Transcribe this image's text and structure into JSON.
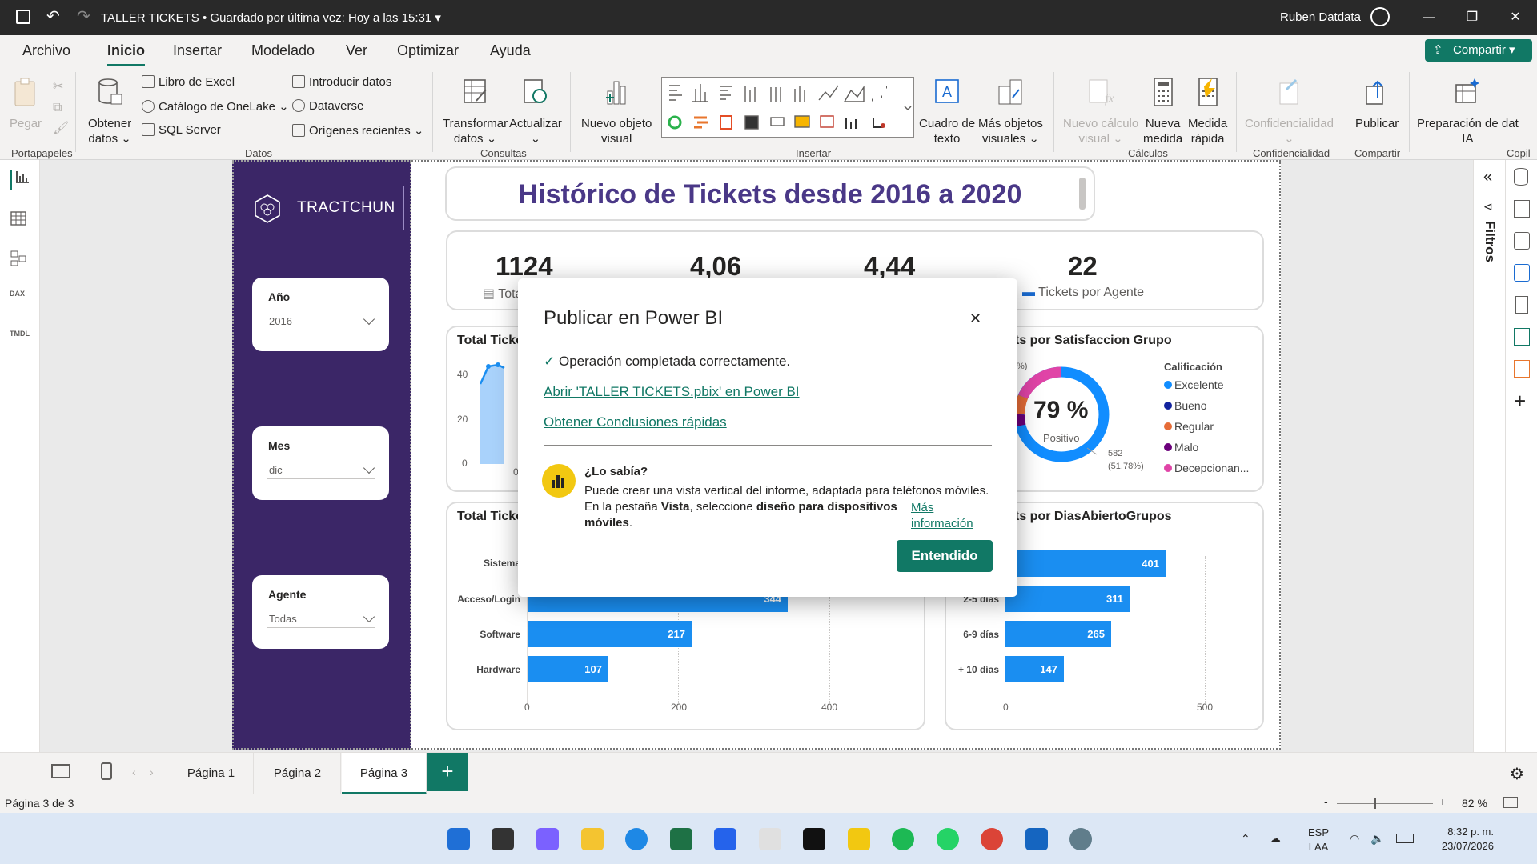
{
  "titlebar": {
    "doc_title": "TALLER TICKETS",
    "saved": "Guardado por última vez: Hoy a las 15:31",
    "user": "Ruben Datdata"
  },
  "menu": [
    "Archivo",
    "Inicio",
    "Insertar",
    "Modelado",
    "Ver",
    "Optimizar",
    "Ayuda"
  ],
  "share_label": "Compartir",
  "ribbon": {
    "pegar": "Pegar",
    "obtener": [
      "Obtener",
      "datos"
    ],
    "excel": "Libro de Excel",
    "onelake": "Catálogo de OneLake",
    "sql": "SQL Server",
    "introducir": "Introducir datos",
    "dataverse": "Dataverse",
    "origenes": "Orígenes recientes",
    "transformar": [
      "Transformar",
      "datos"
    ],
    "actualizar": "Actualizar",
    "nuevo_visual": [
      "Nuevo objeto",
      "visual"
    ],
    "cuadro_texto": [
      "Cuadro de",
      "texto"
    ],
    "mas_objetos": [
      "Más objetos",
      "visuales"
    ],
    "nuevo_calculo": [
      "Nuevo cálculo",
      "visual"
    ],
    "nueva_medida": [
      "Nueva",
      "medida"
    ],
    "medida_rapida": [
      "Medida",
      "rápida"
    ],
    "confidencialidad": "Confidencialidad",
    "publicar": "Publicar",
    "preparacion": [
      "Preparación de dat",
      "IA"
    ],
    "groups": {
      "portapapeles": "Portapapeles",
      "datos": "Datos",
      "consultas": "Consultas",
      "insertar": "Insertar",
      "calculos": "Cálculos",
      "confidencialidad": "Confidencialidad",
      "compartir": "Compartir",
      "copilot": "Copil"
    }
  },
  "report": {
    "logo": "TRACTCHUN",
    "title": "Histórico de Tickets desde 2016 a 2020",
    "slicers": [
      {
        "label": "Año",
        "value": "2016"
      },
      {
        "label": "Mes",
        "value": "dic"
      },
      {
        "label": "Agente",
        "value": "Todas"
      }
    ],
    "kpis": [
      {
        "value": "1124",
        "label": "Tota"
      },
      {
        "value": "4,06",
        "label": ""
      },
      {
        "value": "4,44",
        "label": ""
      },
      {
        "value": "22",
        "label": "Tickets por Agente"
      }
    ],
    "visual_titles": {
      "line": "Total Ticke",
      "donut": "ts por Satisfaccion Grupo",
      "bar_left": "Total Ticke",
      "bar_right": "ts por DiasAbiertoGrupos"
    },
    "line_axis": [
      "40",
      "20",
      "0"
    ],
    "line_xfrag": "0",
    "donut": {
      "center_value": "79 %",
      "center_label": "Positivo",
      "left_frag": "%)",
      "right_label_1": "582",
      "right_label_2": "(51,78%)",
      "legend_title": "Calificación",
      "legend": [
        {
          "name": "Excelente",
          "color": "#118dff"
        },
        {
          "name": "Bueno",
          "color": "#12239e"
        },
        {
          "name": "Regular",
          "color": "#e66c37"
        },
        {
          "name": "Malo",
          "color": "#6b007b"
        },
        {
          "name": "Decepcionan...",
          "color": "#e044a7"
        }
      ]
    },
    "bar_left": {
      "categories": [
        "Sistema",
        "Acceso/Login",
        "Software",
        "Hardware"
      ],
      "values": [
        null,
        344,
        217,
        107
      ],
      "value_labels": [
        "",
        "344",
        "217",
        "107"
      ],
      "ticks": [
        "0",
        "200",
        "400"
      ]
    },
    "bar_right": {
      "categories": [
        "",
        "2-5 días",
        "6-9 días",
        "+ 10 días"
      ],
      "values": [
        401,
        311,
        265,
        147
      ],
      "value_labels": [
        "401",
        "311",
        "265",
        "147"
      ],
      "ticks": [
        "0",
        "500"
      ]
    }
  },
  "dialog": {
    "title": "Publicar en Power BI",
    "success": "Operación completada correctamente.",
    "link_open": "Abrir 'TALLER TICKETS.pbix' en Power BI",
    "link_insights": "Obtener Conclusiones rápidas",
    "tip_title": "¿Lo sabía?",
    "tip_line1": "Puede crear una vista vertical del informe, adaptada para teléfonos móviles.",
    "tip_line2a": "En la pestaña ",
    "tip_vista": "Vista",
    "tip_line2b": ", seleccione ",
    "tip_bold": "diseño para dispositivos",
    "tip_line3": "móviles",
    "more_1": "Más",
    "more_2": "información",
    "ok": "Entendido"
  },
  "filtros_label": "Filtros",
  "tabs": [
    "Página 1",
    "Página 2",
    "Página 3"
  ],
  "status": {
    "page": "Página 3 de 3",
    "zoom": "82 %"
  },
  "taskbar": {
    "lang1": "ESP",
    "lang2": "LAA",
    "time": "8:32 p. m.",
    "date": "23/07/2026"
  }
}
